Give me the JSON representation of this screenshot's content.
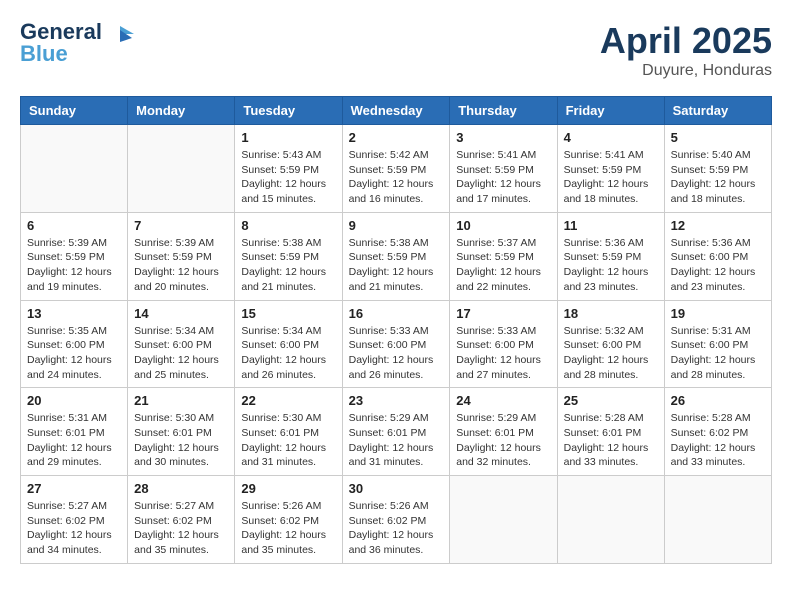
{
  "header": {
    "logo_line1": "General",
    "logo_line2": "Blue",
    "month": "April 2025",
    "location": "Duyure, Honduras"
  },
  "weekdays": [
    "Sunday",
    "Monday",
    "Tuesday",
    "Wednesday",
    "Thursday",
    "Friday",
    "Saturday"
  ],
  "weeks": [
    [
      {
        "day": "",
        "sunrise": "",
        "sunset": "",
        "daylight": ""
      },
      {
        "day": "",
        "sunrise": "",
        "sunset": "",
        "daylight": ""
      },
      {
        "day": "1",
        "sunrise": "Sunrise: 5:43 AM",
        "sunset": "Sunset: 5:59 PM",
        "daylight": "Daylight: 12 hours and 15 minutes."
      },
      {
        "day": "2",
        "sunrise": "Sunrise: 5:42 AM",
        "sunset": "Sunset: 5:59 PM",
        "daylight": "Daylight: 12 hours and 16 minutes."
      },
      {
        "day": "3",
        "sunrise": "Sunrise: 5:41 AM",
        "sunset": "Sunset: 5:59 PM",
        "daylight": "Daylight: 12 hours and 17 minutes."
      },
      {
        "day": "4",
        "sunrise": "Sunrise: 5:41 AM",
        "sunset": "Sunset: 5:59 PM",
        "daylight": "Daylight: 12 hours and 18 minutes."
      },
      {
        "day": "5",
        "sunrise": "Sunrise: 5:40 AM",
        "sunset": "Sunset: 5:59 PM",
        "daylight": "Daylight: 12 hours and 18 minutes."
      }
    ],
    [
      {
        "day": "6",
        "sunrise": "Sunrise: 5:39 AM",
        "sunset": "Sunset: 5:59 PM",
        "daylight": "Daylight: 12 hours and 19 minutes."
      },
      {
        "day": "7",
        "sunrise": "Sunrise: 5:39 AM",
        "sunset": "Sunset: 5:59 PM",
        "daylight": "Daylight: 12 hours and 20 minutes."
      },
      {
        "day": "8",
        "sunrise": "Sunrise: 5:38 AM",
        "sunset": "Sunset: 5:59 PM",
        "daylight": "Daylight: 12 hours and 21 minutes."
      },
      {
        "day": "9",
        "sunrise": "Sunrise: 5:38 AM",
        "sunset": "Sunset: 5:59 PM",
        "daylight": "Daylight: 12 hours and 21 minutes."
      },
      {
        "day": "10",
        "sunrise": "Sunrise: 5:37 AM",
        "sunset": "Sunset: 5:59 PM",
        "daylight": "Daylight: 12 hours and 22 minutes."
      },
      {
        "day": "11",
        "sunrise": "Sunrise: 5:36 AM",
        "sunset": "Sunset: 5:59 PM",
        "daylight": "Daylight: 12 hours and 23 minutes."
      },
      {
        "day": "12",
        "sunrise": "Sunrise: 5:36 AM",
        "sunset": "Sunset: 6:00 PM",
        "daylight": "Daylight: 12 hours and 23 minutes."
      }
    ],
    [
      {
        "day": "13",
        "sunrise": "Sunrise: 5:35 AM",
        "sunset": "Sunset: 6:00 PM",
        "daylight": "Daylight: 12 hours and 24 minutes."
      },
      {
        "day": "14",
        "sunrise": "Sunrise: 5:34 AM",
        "sunset": "Sunset: 6:00 PM",
        "daylight": "Daylight: 12 hours and 25 minutes."
      },
      {
        "day": "15",
        "sunrise": "Sunrise: 5:34 AM",
        "sunset": "Sunset: 6:00 PM",
        "daylight": "Daylight: 12 hours and 26 minutes."
      },
      {
        "day": "16",
        "sunrise": "Sunrise: 5:33 AM",
        "sunset": "Sunset: 6:00 PM",
        "daylight": "Daylight: 12 hours and 26 minutes."
      },
      {
        "day": "17",
        "sunrise": "Sunrise: 5:33 AM",
        "sunset": "Sunset: 6:00 PM",
        "daylight": "Daylight: 12 hours and 27 minutes."
      },
      {
        "day": "18",
        "sunrise": "Sunrise: 5:32 AM",
        "sunset": "Sunset: 6:00 PM",
        "daylight": "Daylight: 12 hours and 28 minutes."
      },
      {
        "day": "19",
        "sunrise": "Sunrise: 5:31 AM",
        "sunset": "Sunset: 6:00 PM",
        "daylight": "Daylight: 12 hours and 28 minutes."
      }
    ],
    [
      {
        "day": "20",
        "sunrise": "Sunrise: 5:31 AM",
        "sunset": "Sunset: 6:01 PM",
        "daylight": "Daylight: 12 hours and 29 minutes."
      },
      {
        "day": "21",
        "sunrise": "Sunrise: 5:30 AM",
        "sunset": "Sunset: 6:01 PM",
        "daylight": "Daylight: 12 hours and 30 minutes."
      },
      {
        "day": "22",
        "sunrise": "Sunrise: 5:30 AM",
        "sunset": "Sunset: 6:01 PM",
        "daylight": "Daylight: 12 hours and 31 minutes."
      },
      {
        "day": "23",
        "sunrise": "Sunrise: 5:29 AM",
        "sunset": "Sunset: 6:01 PM",
        "daylight": "Daylight: 12 hours and 31 minutes."
      },
      {
        "day": "24",
        "sunrise": "Sunrise: 5:29 AM",
        "sunset": "Sunset: 6:01 PM",
        "daylight": "Daylight: 12 hours and 32 minutes."
      },
      {
        "day": "25",
        "sunrise": "Sunrise: 5:28 AM",
        "sunset": "Sunset: 6:01 PM",
        "daylight": "Daylight: 12 hours and 33 minutes."
      },
      {
        "day": "26",
        "sunrise": "Sunrise: 5:28 AM",
        "sunset": "Sunset: 6:02 PM",
        "daylight": "Daylight: 12 hours and 33 minutes."
      }
    ],
    [
      {
        "day": "27",
        "sunrise": "Sunrise: 5:27 AM",
        "sunset": "Sunset: 6:02 PM",
        "daylight": "Daylight: 12 hours and 34 minutes."
      },
      {
        "day": "28",
        "sunrise": "Sunrise: 5:27 AM",
        "sunset": "Sunset: 6:02 PM",
        "daylight": "Daylight: 12 hours and 35 minutes."
      },
      {
        "day": "29",
        "sunrise": "Sunrise: 5:26 AM",
        "sunset": "Sunset: 6:02 PM",
        "daylight": "Daylight: 12 hours and 35 minutes."
      },
      {
        "day": "30",
        "sunrise": "Sunrise: 5:26 AM",
        "sunset": "Sunset: 6:02 PM",
        "daylight": "Daylight: 12 hours and 36 minutes."
      },
      {
        "day": "",
        "sunrise": "",
        "sunset": "",
        "daylight": ""
      },
      {
        "day": "",
        "sunrise": "",
        "sunset": "",
        "daylight": ""
      },
      {
        "day": "",
        "sunrise": "",
        "sunset": "",
        "daylight": ""
      }
    ]
  ]
}
